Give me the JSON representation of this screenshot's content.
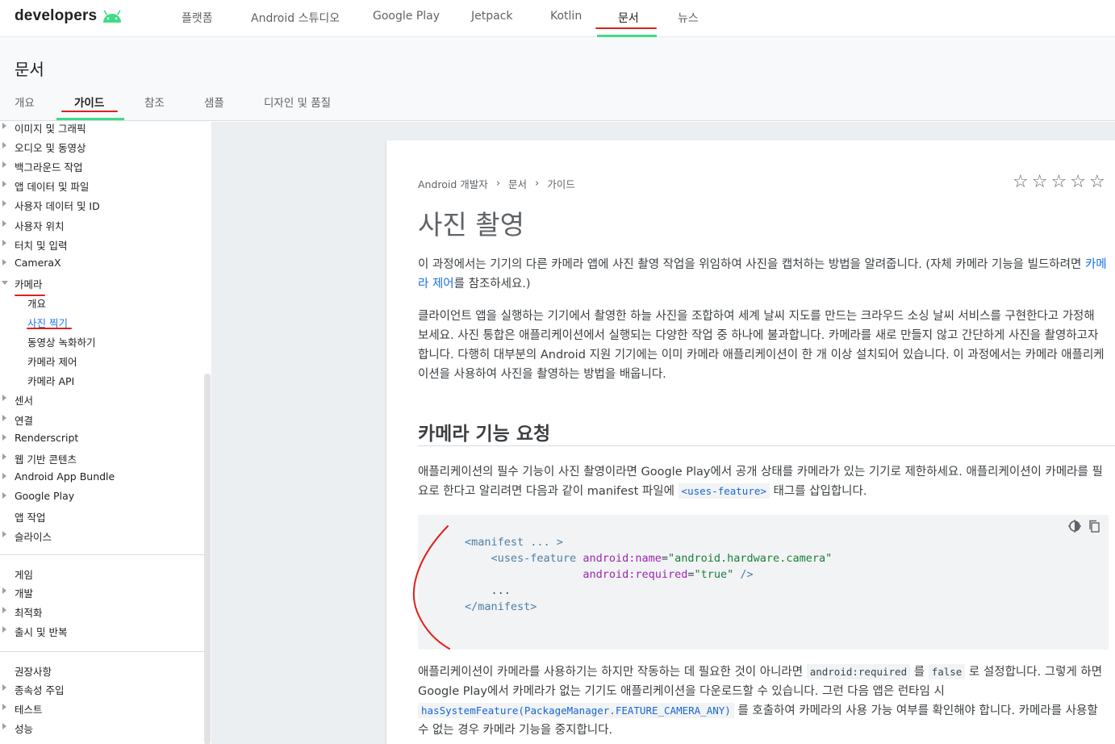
{
  "topbar": {
    "logo_text": "developers",
    "nav": [
      "플랫폼",
      "Android 스튜디오",
      "Google Play",
      "Jetpack",
      "Kotlin",
      "문서",
      "뉴스"
    ],
    "active_nav": "문서"
  },
  "docheader": {
    "title": "문서",
    "tabs": [
      "개요",
      "가이드",
      "참조",
      "샘플",
      "디자인 및 품질"
    ],
    "active_tab": "가이드"
  },
  "sidebar": {
    "items": [
      {
        "label": "이미지 및 그래픽",
        "arrow": "closed"
      },
      {
        "label": "오디오 및 동영상",
        "arrow": "closed"
      },
      {
        "label": "백그라운드 작업",
        "arrow": "closed"
      },
      {
        "label": "앱 데이터 및 파일",
        "arrow": "closed"
      },
      {
        "label": "사용자 데이터 및 ID",
        "arrow": "closed"
      },
      {
        "label": "사용자 위치",
        "arrow": "closed"
      },
      {
        "label": "터치 및 입력",
        "arrow": "closed"
      },
      {
        "label": "CameraX",
        "arrow": "closed"
      },
      {
        "label": "카메라",
        "arrow": "open"
      },
      {
        "label": "개요",
        "arrow": "none"
      },
      {
        "label": "사진 찍기",
        "arrow": "none",
        "active": true
      },
      {
        "label": "동영상 녹화하기",
        "arrow": "none"
      },
      {
        "label": "카메라 제어",
        "arrow": "none"
      },
      {
        "label": "카메라 API",
        "arrow": "none"
      },
      {
        "label": "센서",
        "arrow": "closed"
      },
      {
        "label": "연결",
        "arrow": "closed"
      },
      {
        "label": "Renderscript",
        "arrow": "closed"
      },
      {
        "label": "웹 기반 콘텐츠",
        "arrow": "closed"
      },
      {
        "label": "Android App Bundle",
        "arrow": "closed"
      },
      {
        "label": "Google Play",
        "arrow": "closed"
      },
      {
        "label": "앱 작업",
        "arrow": "none"
      },
      {
        "label": "슬라이스",
        "arrow": "closed"
      }
    ],
    "section2": {
      "heading": "게임",
      "items": [
        {
          "label": "개발",
          "arrow": "closed"
        },
        {
          "label": "최적화",
          "arrow": "closed"
        },
        {
          "label": "출시 및 반복",
          "arrow": "closed"
        }
      ]
    },
    "section3": {
      "heading": "권장사항",
      "items": [
        {
          "label": "종속성 주입",
          "arrow": "closed"
        },
        {
          "label": "테스트",
          "arrow": "closed"
        },
        {
          "label": "성능",
          "arrow": "closed"
        }
      ]
    }
  },
  "article": {
    "breadcrumb": [
      "Android 개발자",
      "문서",
      "가이드"
    ],
    "title": "사진 촬영",
    "intro_text": "이 과정에서는 기기의 다른 카메라 앱에 사진 촬영 작업을 위임하여 사진을 캡처하는 방법을 알려줍니다. (자체 카메라 기능을 빌드하려면 ",
    "intro_link": "카메라 제어",
    "intro_tail": "를 참조하세요.)",
    "para2": "클라이언트 앱을 실행하는 기기에서 촬영한 하늘 사진을 조합하여 세계 날씨 지도를 만드는 크라우드 소싱 날씨 서비스를 구현한다고 가정해 보세요. 사진 통합은 애플리케이션에서 실행되는 다양한 작업 중 하나에 불과합니다. 카메라를 새로 만들지 않고 간단하게 사진을 촬영하고자 합니다. 다행히 대부분의 Android 지원 기기에는 이미 카메라 애플리케이션이 한 개 이상 설치되어 있습니다. 이 과정에서는 카메라 애플리케이션을 사용하여 사진을 촬영하는 방법을 배웁니다.",
    "h2": "카메라 기능 요청",
    "para3_a": "애플리케이션의 필수 기능이 사진 촬영이라면 Google Play에서 공개 상태를 카메라가 있는 기기로 제한하세요. 애플리케이션이 카메라를 필요로 한다고 알리려면 다음과 같이 manifest 파일에 ",
    "para3_code": "<uses-feature>",
    "para3_b": " 태그를 삽입합니다.",
    "code": {
      "l1": "<manifest ... >",
      "l2_tag": "<uses-feature",
      "l2_attr": "android:name",
      "l2_val": "\"android.hardware.camera\"",
      "l3_attr": "android:required",
      "l3_val": "\"true\"",
      "l3_close": "/>",
      "l4": "...",
      "l5": "</manifest>"
    },
    "para4_a": "애플리케이션이 카메라를 사용하기는 하지만 작동하는 데 필요한 것이 아니라면 ",
    "para4_code1": "android:required",
    "para4_b": " 를 ",
    "para4_code2": "false",
    "para4_c": " 로 설정합니다. 그렇게 하면 Google Play에서 카메라가 없는 기기도 애플리케이션을 다운로드할 수 있습니다. 그런 다음 앱은 런타임 시 ",
    "para4_code3": "hasSystemFeature(PackageManager.FEATURE_CAMERA_ANY)",
    "para4_d": " 를 호출하여 카메라의 사용 가능 여부를 확인해야 합니다. 카메라를 사용할 수 없는 경우 카메라 기능을 중지합니다."
  },
  "colors": {
    "accent_green": "#3ddc84",
    "link_blue": "#1a73e8",
    "annotation_red": "#e0201b"
  }
}
